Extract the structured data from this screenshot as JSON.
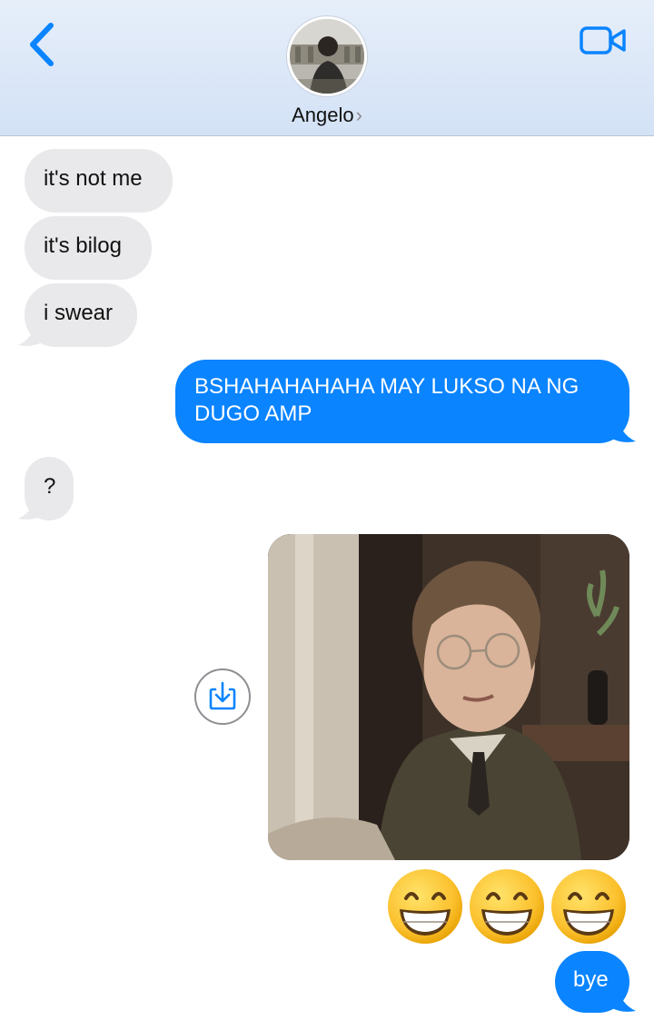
{
  "header": {
    "contact_name": "Angelo",
    "name_chevron": "›",
    "back_icon": "chevron-left-icon",
    "video_icon": "video-camera-icon",
    "accent": "#0a84ff"
  },
  "messages": [
    {
      "side": "incoming",
      "text": "it's not me"
    },
    {
      "side": "incoming",
      "text": "it's bilog"
    },
    {
      "side": "incoming",
      "text": "i swear"
    },
    {
      "side": "outgoing",
      "text_line1": "BSHAHAHAHAHA MAY LUKSO NA NG",
      "text_line2": "DUGO AMP"
    },
    {
      "side": "incoming",
      "text": "?"
    },
    {
      "side": "outgoing",
      "type": "photo"
    },
    {
      "side": "outgoing",
      "type": "emoji",
      "emoji_name": "grinning-face-with-smiling-eyes",
      "count": 3
    },
    {
      "side": "outgoing",
      "text": "bye"
    }
  ],
  "colors": {
    "incoming_bubble": "#e9e9eb",
    "outgoing_bubble": "#0a84ff",
    "header_bg": "#d9e6f7"
  }
}
